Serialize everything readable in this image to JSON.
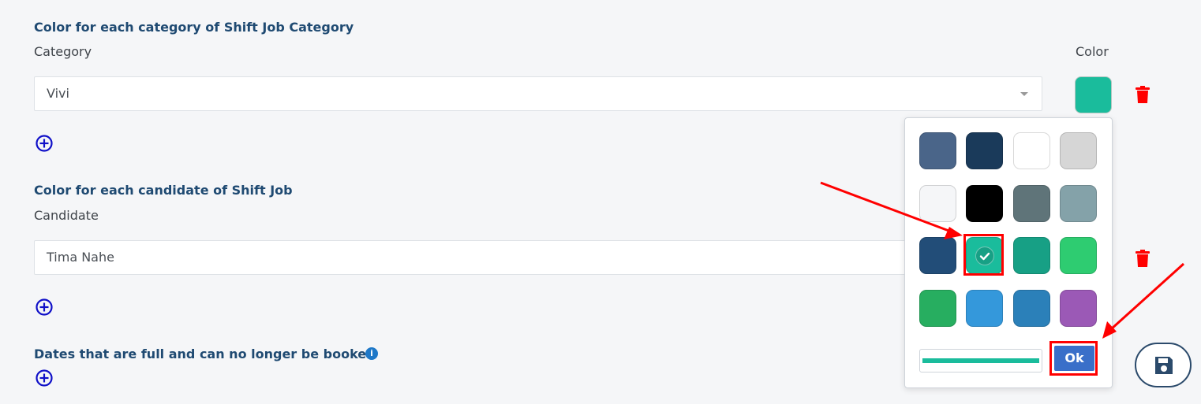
{
  "sections": {
    "category": {
      "title": "Color for each category of Shift Job Category",
      "field_label": "Category",
      "color_label": "Color",
      "value": "Vivi",
      "chip_color": "#1abc9c"
    },
    "candidate": {
      "title": "Color for each candidate of Shift Job",
      "field_label": "Candidate",
      "value": "Tima Nahe"
    },
    "dates": {
      "title": "Dates that are full and can no longer be booked",
      "info_glyph": "i"
    }
  },
  "picker": {
    "swatches": [
      "#4a6589",
      "#1a3a5a",
      "#ffffff",
      "#d6d6d6",
      "#f5f6f8",
      "#000000",
      "#5f7479",
      "#84a2a9",
      "#224d78",
      "#1abc9c",
      "#17a085",
      "#2ecc71",
      "#27ae60",
      "#3498db",
      "#2b80b9",
      "#9b59b6"
    ],
    "selected_index": 9,
    "current_value_color": "#1abc9c",
    "ok_label": "Ok"
  },
  "icons": {
    "add": "plus-circle-icon",
    "delete": "trash-icon",
    "save": "floppy-disk-icon",
    "check": "check-icon",
    "info": "info-icon"
  }
}
